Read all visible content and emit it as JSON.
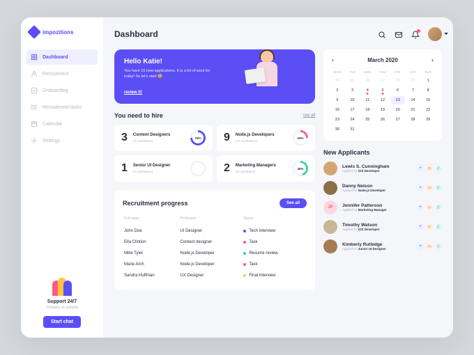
{
  "brand": "impozitions",
  "nav": [
    {
      "label": "Dashboard",
      "icon": "grid",
      "active": true
    },
    {
      "label": "Recruitment",
      "icon": "user",
      "active": false
    },
    {
      "label": "Onboarding",
      "icon": "check-square",
      "active": false
    },
    {
      "label": "Recruitment tasks",
      "icon": "list",
      "active": false
    },
    {
      "label": "Calendar",
      "icon": "calendar",
      "active": false
    },
    {
      "label": "Settings",
      "icon": "gear",
      "active": false
    }
  ],
  "support": {
    "title": "Support 24/7",
    "subtitle": "Contacts us anytime",
    "button": "Start chat"
  },
  "page_title": "Dashboard",
  "hero": {
    "greeting": "Hello Katie!",
    "message": "You have 16 new applications. It is a lot of work for today! So let's start 😉",
    "link": "review it!"
  },
  "hire": {
    "heading": "You need to hire",
    "see_all": "see all",
    "cards": [
      {
        "count": "3",
        "role": "Content Designers",
        "candidates": "(5 candidates)",
        "pct": "75%",
        "color": "#5b4ef5",
        "deg": 270
      },
      {
        "count": "9",
        "role": "Node.js Developers",
        "candidates": "(12 candidates)",
        "pct": "25%",
        "color": "#ff5b7f",
        "deg": 90
      },
      {
        "count": "1",
        "role": "Senior UI Designer",
        "candidates": "(0 candidates)",
        "pct": "",
        "color": "#d4d8e3",
        "deg": 0
      },
      {
        "count": "2",
        "role": "Marketing Managers",
        "candidates": "(3 candidates)",
        "pct": "45%",
        "color": "#3dd598",
        "deg": 162
      }
    ]
  },
  "progress": {
    "title": "Recruitment progress",
    "button": "See all",
    "columns": [
      "Full name",
      "Profession",
      "Status"
    ],
    "rows": [
      {
        "name": "John Doe",
        "prof": "UI Designer",
        "status": "Tech interview",
        "color": "#5b4ef5"
      },
      {
        "name": "Ella Clintion",
        "prof": "Content designer",
        "status": "Task",
        "color": "#ff5b7f"
      },
      {
        "name": "Mike Tyler",
        "prof": "Node.js Developer",
        "status": "Resume review",
        "color": "#3dd598"
      },
      {
        "name": "Marie Arch",
        "prof": "Node.js Developer",
        "status": "Task",
        "color": "#ff5b7f"
      },
      {
        "name": "Sandra Huffman",
        "prof": "UX Designer",
        "status": "Final interview",
        "color": "#ffc542"
      }
    ]
  },
  "calendar": {
    "month": "March 2020",
    "dow": [
      "MON",
      "TUE",
      "WED",
      "THU",
      "FRI",
      "SAT",
      "SUN"
    ],
    "days": [
      {
        "n": "24",
        "muted": true
      },
      {
        "n": "25",
        "muted": true
      },
      {
        "n": "26",
        "muted": true
      },
      {
        "n": "27",
        "muted": true
      },
      {
        "n": "28",
        "muted": true
      },
      {
        "n": "29",
        "muted": true
      },
      {
        "n": "1"
      },
      {
        "n": "2"
      },
      {
        "n": "3"
      },
      {
        "n": "4",
        "marked": true
      },
      {
        "n": "5",
        "marked": true
      },
      {
        "n": "6"
      },
      {
        "n": "7"
      },
      {
        "n": "8"
      },
      {
        "n": "9"
      },
      {
        "n": "10"
      },
      {
        "n": "11"
      },
      {
        "n": "12"
      },
      {
        "n": "13",
        "today": true
      },
      {
        "n": "14"
      },
      {
        "n": "15"
      },
      {
        "n": "16"
      },
      {
        "n": "17"
      },
      {
        "n": "18"
      },
      {
        "n": "19"
      },
      {
        "n": "20"
      },
      {
        "n": "21"
      },
      {
        "n": "22"
      },
      {
        "n": "23"
      },
      {
        "n": "24"
      },
      {
        "n": "25"
      },
      {
        "n": "26"
      },
      {
        "n": "27"
      },
      {
        "n": "28"
      },
      {
        "n": "29"
      },
      {
        "n": "30"
      },
      {
        "n": "31"
      }
    ]
  },
  "applicants": {
    "title": "New Applicants",
    "list": [
      {
        "name": "Lewis S. Cunningham",
        "role": "iOS Developer",
        "avatar": "#d4a574"
      },
      {
        "name": "Danny Nelson",
        "role": "Node.js Developer",
        "avatar": "#8b6f47"
      },
      {
        "name": "Jennifer Patterson",
        "role": "Marketing Manager",
        "avatar": "#ffd7e0",
        "initials": "JP"
      },
      {
        "name": "Timothy Watson",
        "role": "iOS Developer",
        "avatar": "#c9b896"
      },
      {
        "name": "Kimberly Rutledge",
        "role": "Junior UI Designer",
        "avatar": "#a67c52"
      }
    ],
    "applied_prefix": "Applied for "
  }
}
